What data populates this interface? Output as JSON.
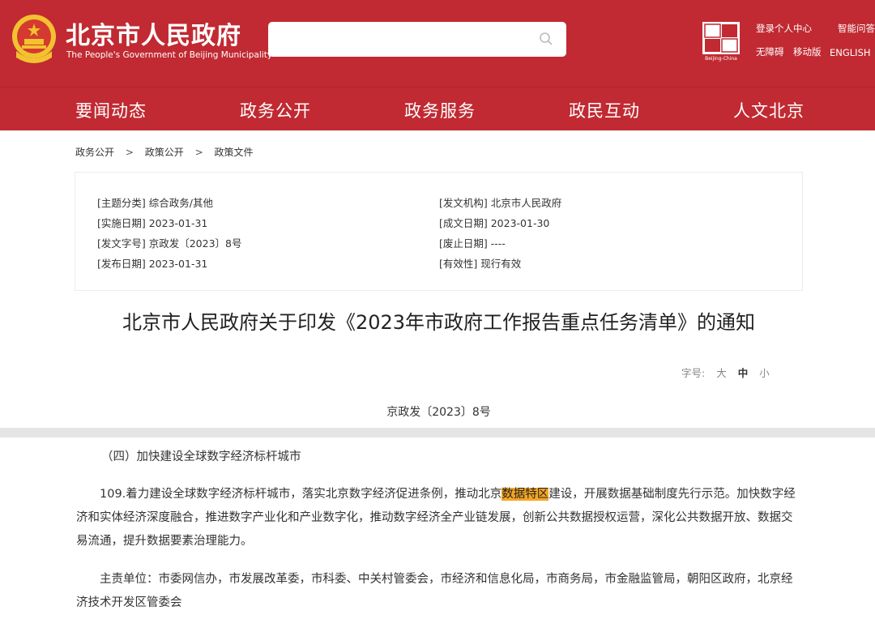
{
  "header": {
    "site_name": "北京市人民政府",
    "site_name_en": "The People's Government of Beijing Municipality",
    "search": {
      "placeholder": ""
    },
    "links": {
      "login": "登录个人中心",
      "smart_qa": "智能问答",
      "accessible": "无障碍",
      "mobile": "移动版",
      "language": "ENGLISH"
    },
    "capital_logo_text": "Beijing-China"
  },
  "nav": {
    "items": [
      "要闻动态",
      "政务公开",
      "政务服务",
      "政民互动",
      "人文北京"
    ]
  },
  "breadcrumb": [
    "政务公开",
    "政策公开",
    "政策文件"
  ],
  "breadcrumb_sep": ">",
  "meta": {
    "topic": "[主题分类] 综合政务/其他",
    "issuer": "[发文机构] 北京市人民政府",
    "effective_date": "[实施日期] 2023-01-31",
    "written_date": "[成文日期] 2023-01-30",
    "doc_no": "[发文字号] 京政发〔2023〕8号",
    "expiry_date": "[废止日期] ----",
    "publish_date": "[发布日期] 2023-01-31",
    "validity": "[有效性] 现行有效"
  },
  "document": {
    "title": "北京市人民政府关于印发《2023年市政府工作报告重点任务清单》的通知",
    "font_size_label": "字号:",
    "font_sizes": [
      "大",
      "中",
      "小"
    ],
    "number": "京政发〔2023〕8号",
    "section_heading": "（四）加快建设全球数字经济标杆城市",
    "para1_before": "109.着力建设全球数字经济标杆城市，落实北京数字经济促进条例，推动北京",
    "para1_highlight": "数据特区",
    "para1_after": "建设，开展数据基础制度先行示范。加快数字经济和实体经济深度融合，推进数字产业化和产业数字化，推动数字经济全产业链发展，创新公共数据授权运营，深化公共数据开放、数据交易流通，提升数据要素治理能力。",
    "para2": "主责单位：市委网信办，市发展改革委，市科委、中关村管委会，市经济和信息化局，市商务局，市金融监管局，朝阳区政府，北京经济技术开发区管委会"
  },
  "colors": {
    "brand_red": "#c12a32",
    "highlight": "#f5a623"
  }
}
